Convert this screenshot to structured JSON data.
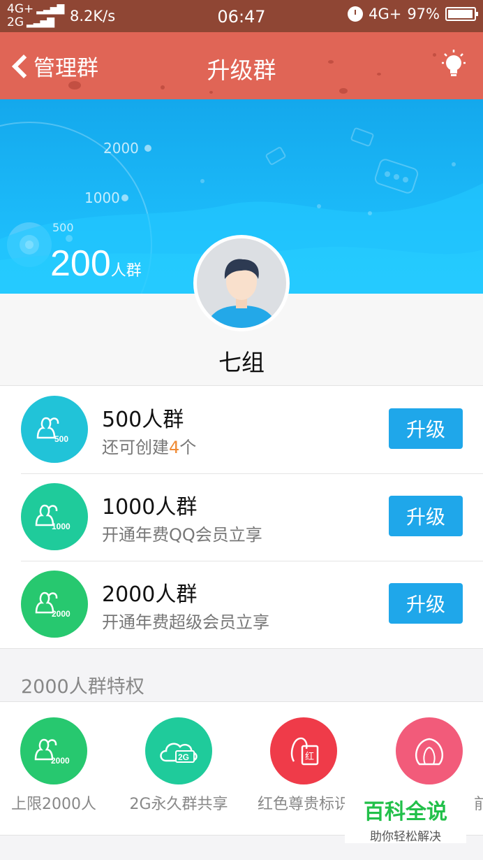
{
  "status_bar": {
    "network_top": "4G+",
    "network_bottom": "2G",
    "speed": "8.2K/s",
    "time": "06:47",
    "network_right": "4G+",
    "battery": "97%",
    "battery_level": 0.97
  },
  "nav": {
    "back_label": "管理群",
    "title": "升级群",
    "bulb_icon": "lightbulb-icon"
  },
  "hero": {
    "tiers": [
      "2000",
      "1000",
      "500"
    ],
    "current_count": "200",
    "current_unit": "人群"
  },
  "group": {
    "name": "七组"
  },
  "upgrade_options": [
    {
      "title": "500人群",
      "sub_prefix": "还可创建",
      "sub_highlight": "4",
      "sub_suffix": "个",
      "badge": "500",
      "color": "#21c3d8",
      "button": "升级"
    },
    {
      "title": "1000人群",
      "sub_prefix": "开通年费QQ会员立享",
      "sub_highlight": "",
      "sub_suffix": "",
      "badge": "1000",
      "color": "#1fcb9b",
      "button": "升级"
    },
    {
      "title": "2000人群",
      "sub_prefix": "开通年费超级会员立享",
      "sub_highlight": "",
      "sub_suffix": "",
      "badge": "2000",
      "color": "#27c86f",
      "button": "升级"
    }
  ],
  "privileges": {
    "section_title": "2000人群特权",
    "items": [
      {
        "label": "上限2000人",
        "badge": "2000",
        "color": "#27c86f",
        "icon": "group-icon"
      },
      {
        "label": "2G永久群共享",
        "badge": "2G",
        "color": "#1fcb9b",
        "icon": "cloud-icon"
      },
      {
        "label": "红色尊贵标识",
        "badge": "红",
        "color": "#ef3b49",
        "icon": "penguin-badge-icon"
      },
      {
        "label": "前",
        "badge": "",
        "color": "#f25b7a",
        "icon": "penguin-icon"
      }
    ]
  },
  "watermark": {
    "main": "百科全说",
    "sub": "助你轻松解决"
  }
}
